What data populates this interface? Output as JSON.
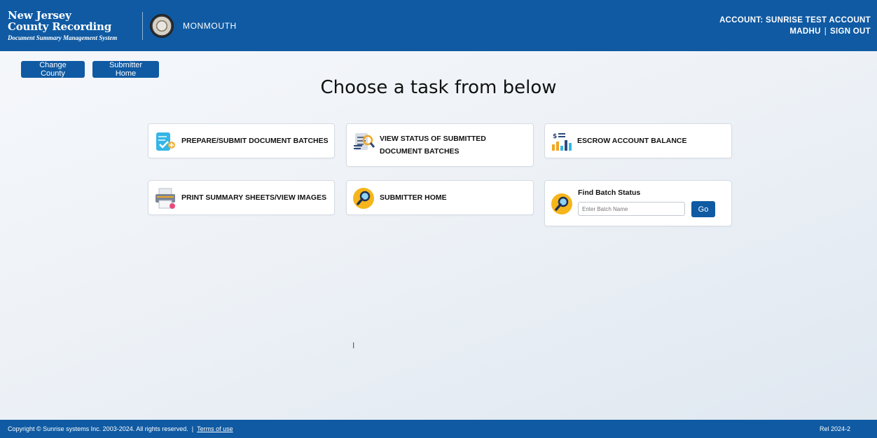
{
  "header": {
    "brand_line1": "New Jersey",
    "brand_line2": "County Recording",
    "brand_subtitle": "Document Summary Management System",
    "county": "MONMOUTH",
    "account_label": "ACCOUNT: SUNRISE TEST ACCOUNT",
    "user": "MADHU",
    "separator": "|",
    "sign_out": "SIGN OUT"
  },
  "toolbar": {
    "change_county": "Change County",
    "submitter_home": "Submitter Home"
  },
  "main": {
    "title": "Choose a task from below",
    "tasks": [
      {
        "label": "PREPARE/SUBMIT DOCUMENT BATCHES",
        "icon": "document-submit-icon"
      },
      {
        "label_line1": "VIEW STATUS OF SUBMITTED",
        "label_line2": "DOCUMENT BATCHES",
        "icon": "magnifier-document-icon"
      },
      {
        "label": "ESCROW ACCOUNT BALANCE",
        "icon": "account-balance-chart-icon"
      },
      {
        "label": "PRINT SUMMARY SHEETS/VIEW IMAGES",
        "icon": "printer-icon"
      },
      {
        "label": "SUBMITTER HOME",
        "icon": "search-circle-icon"
      }
    ],
    "find_batch": {
      "title": "Find Batch Status",
      "placeholder": "Enter Batch Name",
      "go_label": "Go",
      "icon": "search-circle-icon"
    }
  },
  "footer": {
    "copyright": "Copyright © Sunrise systems Inc. 2003-2024. All rights reserved.",
    "separator": "|",
    "terms": "Terms of use",
    "release": "Rel 2024-2"
  },
  "colors": {
    "primary": "#0f5aa3",
    "card_border": "#d6dce4",
    "background": "#eef2f7"
  }
}
